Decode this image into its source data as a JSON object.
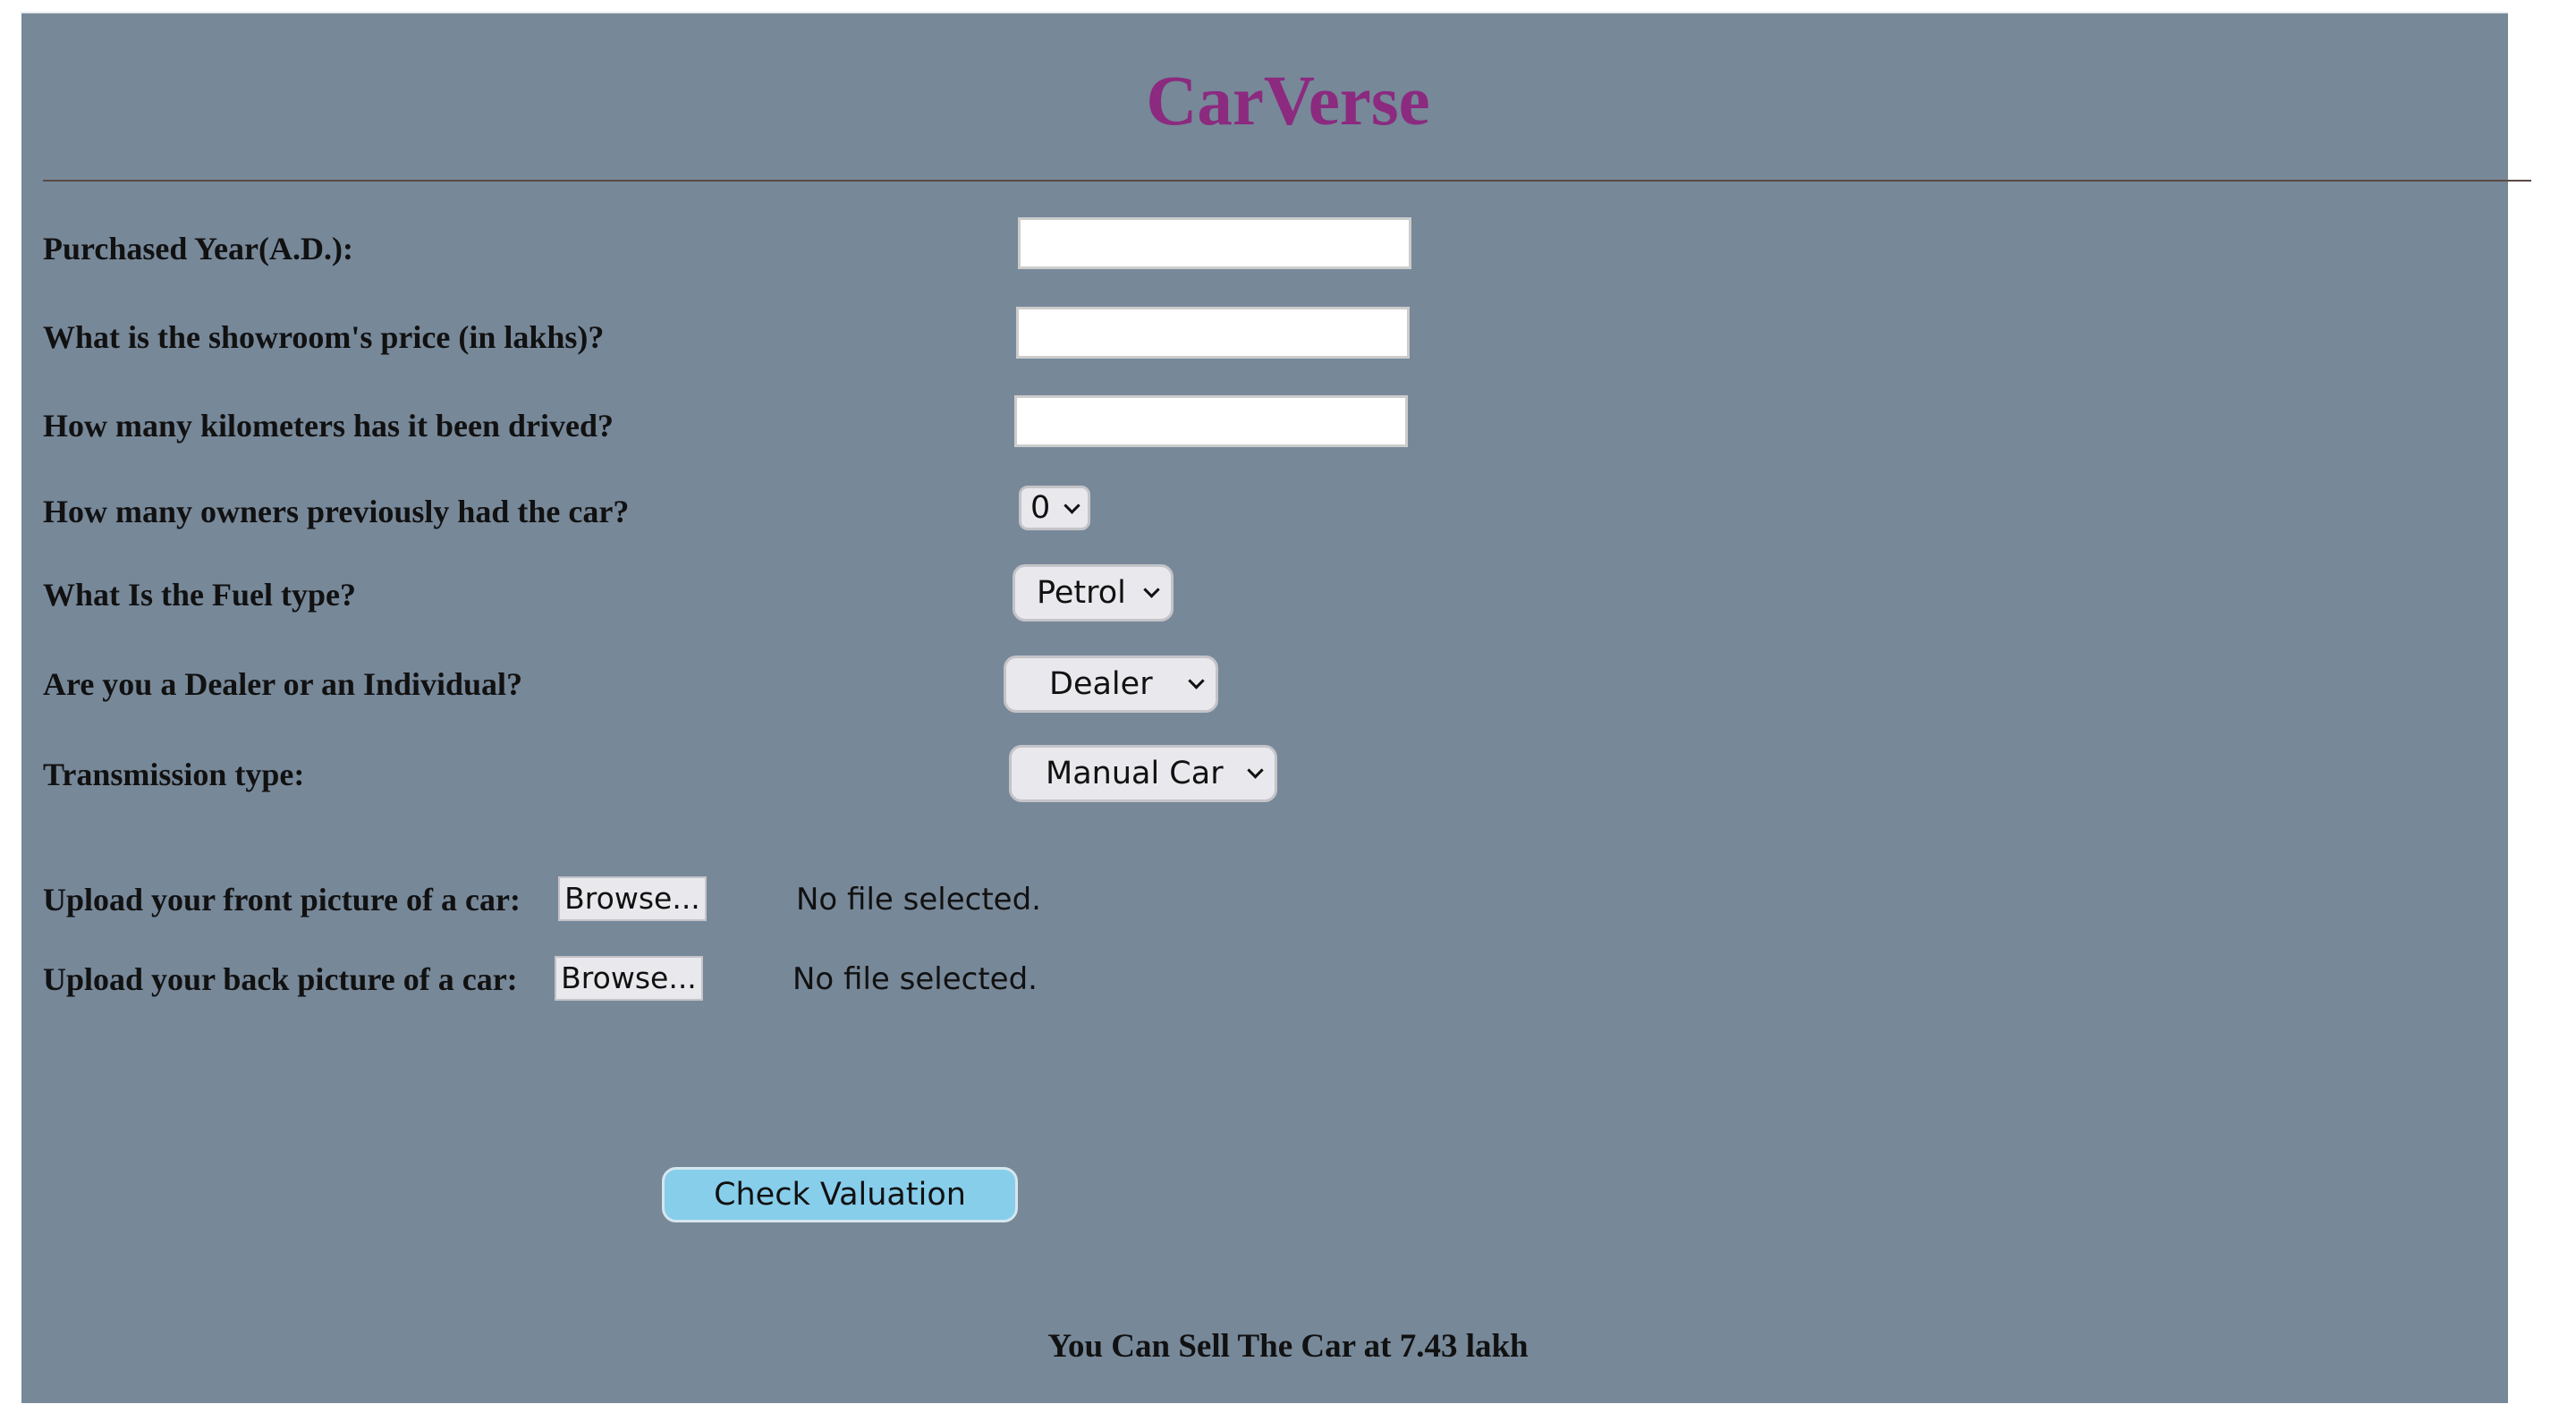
{
  "app": {
    "title": "CarVerse"
  },
  "form": {
    "purchased_year": {
      "label": "Purchased Year(A.D.):",
      "value": ""
    },
    "showroom_price": {
      "label": "What is the showroom's price (in lakhs)?",
      "value": ""
    },
    "kilometers": {
      "label": "How many kilometers has it been drived?",
      "value": ""
    },
    "owners": {
      "label": "How many owners previously had the car?",
      "selected": "0"
    },
    "fuel_type": {
      "label": "What Is the Fuel type?",
      "selected": "Petrol"
    },
    "seller_type": {
      "label": "Are you a Dealer or an Individual?",
      "selected": "Dealer"
    },
    "transmission": {
      "label": "Transmission type:",
      "selected": "Manual Car"
    },
    "front_picture": {
      "label": "Upload your front picture of a car:",
      "button_label": "Browse...",
      "status": "No file selected."
    },
    "back_picture": {
      "label": "Upload your back picture of a car:",
      "button_label": "Browse...",
      "status": "No file selected."
    },
    "submit_label": "Check Valuation"
  },
  "result": {
    "text": "You Can Sell The Car at 7.43 lakh"
  },
  "colors": {
    "background": "#778899",
    "title": "#8b2a7f",
    "button": "#87ceeb"
  },
  "icons": {
    "dropdown": "chevron-down-icon"
  }
}
